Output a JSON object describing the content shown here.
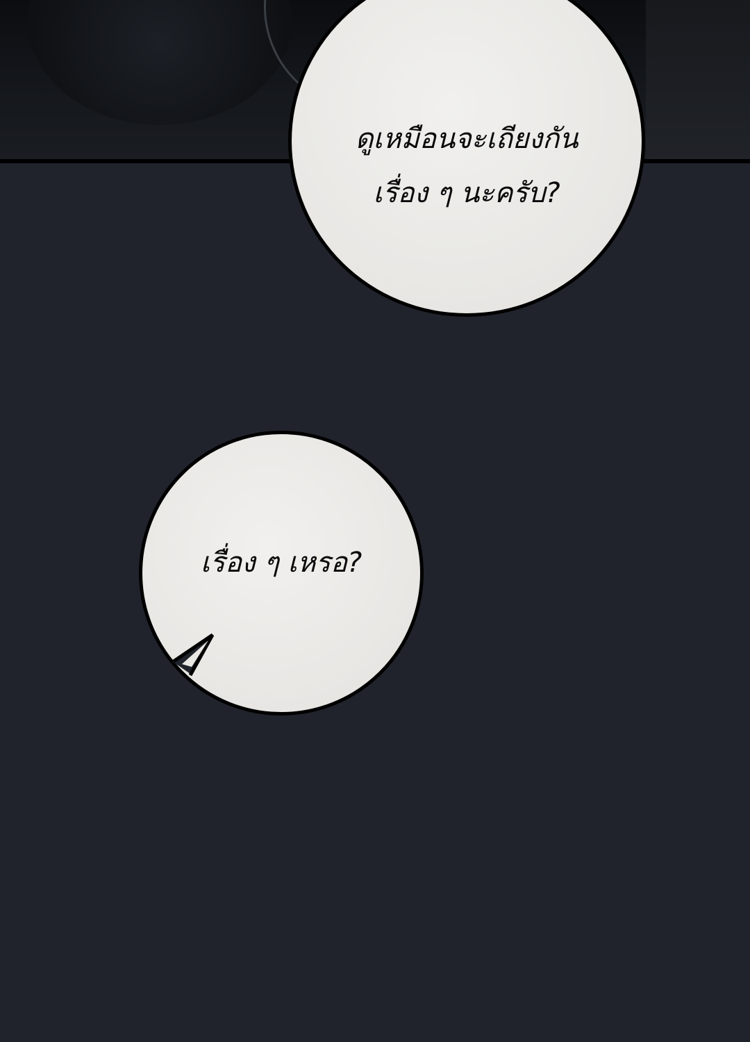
{
  "panels": {
    "top": {
      "description_color": "#0b0d10"
    },
    "background_color": "#20232b"
  },
  "bubbles": [
    {
      "text": "ดูเหมือนจะเถียงกัน\nเรื่อง ๆ นะครับ?"
    },
    {
      "text": "เรื่อง ๆ เหรอ?"
    }
  ]
}
